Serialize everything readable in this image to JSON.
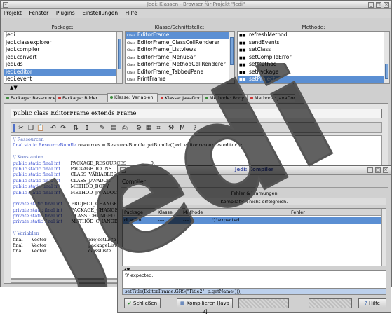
{
  "main_window": {
    "title": "Jedi: Klassen - Browser für Projekt \"Jedi\"",
    "menu": [
      "Projekt",
      "Fenster",
      "Plugins",
      "Einstellungen",
      "Hilfe"
    ],
    "package_header": "Package:",
    "class_header": "Klasse/Schnittstelle:",
    "method_header": "Methode:",
    "packages": [
      "jedi",
      "jedi.classexplorer",
      "jedi.compiler",
      "jedi.convert",
      "jedi.ds",
      "jedi.editor",
      "jedi.event"
    ],
    "classes": [
      "EditorFrame",
      "EditorFrame_ClassCellRenderer",
      "EditorFrame_Listviews",
      "EditorFrame_MenuBar",
      "EditorFrame_MethodCellRenderer",
      "EditorFrame_TabbedPane",
      "PrintFrame"
    ],
    "class_badge": "Class",
    "methods": [
      "refreshMethod",
      "sendEvents",
      "setClass",
      "setCompileError",
      "setMethod",
      "setPackage",
      "setProject"
    ],
    "tabs": [
      "Package: Ressourcen",
      "Package: Bilder",
      "Klasse: Variablen",
      "Klasse: JavaDoc",
      "Methode: Body",
      "Methode: JavaDoc"
    ],
    "declaration": "public class EditorFrame extends Frame",
    "code_lines": [
      {
        "cls": "cm",
        "text": "// Ressourcen"
      },
      {
        "cls": "",
        "text": "final static ResourceBundle resources = ResourceBundle.getBundle(\"jedi.editor.resources.editor\");"
      },
      {
        "cls": "",
        "text": ""
      },
      {
        "cls": "cm",
        "text": "// Konstanten"
      },
      {
        "cls": "",
        "text": "public static final int       PACKAGE_RESOURCES          =    0;"
      },
      {
        "cls": "",
        "text": "public static final int       PACKAGE_ICONS"
      },
      {
        "cls": "",
        "text": "public static final int       CLASS_VARIABLES"
      },
      {
        "cls": "",
        "text": "public static final int       CLASS_JAVADOC"
      },
      {
        "cls": "",
        "text": "public static final int       METHOD_BODY"
      },
      {
        "cls": "",
        "text": "public static final int       METHOD_JAVADOC"
      },
      {
        "cls": "",
        "text": ""
      },
      {
        "cls": "",
        "text": "private static final int      PROJECT_CHANGED"
      },
      {
        "cls": "",
        "text": "private static final int      PACKAGE_CHANGED"
      },
      {
        "cls": "",
        "text": "private static final int      CLASS_CHANGED"
      },
      {
        "cls": "",
        "text": "private static final int      METHOD_CHANGED"
      },
      {
        "cls": "",
        "text": ""
      },
      {
        "cls": "cm",
        "text": "// Variablen"
      },
      {
        "cls": "",
        "text": "final      Vector                             projectListe"
      },
      {
        "cls": "",
        "text": "final      Vector                             packageListe"
      },
      {
        "cls": "",
        "text": "final      Vector                             classListe"
      }
    ]
  },
  "compiler_dialog": {
    "title": "Jedi: Compiler",
    "heading": "Compiler",
    "group_label": "Fehler & Warnungen",
    "status": "Kompilation nicht erfolgreich.",
    "columns": [
      "Package",
      "Klasse",
      "Methode",
      "Fehler"
    ],
    "rows": [
      {
        "package": "di.editor",
        "klasse": "----",
        "methode": "----",
        "fehler": "')' expected."
      }
    ],
    "message": "')' expected.",
    "source_line": "setTitle(EditorFrame.GRS(\"Title2\", p.getName()));",
    "buttons": [
      "Schließen",
      "Kompilieren [Java 2]",
      "Hilfe"
    ]
  },
  "watermark_text": "Jedi"
}
